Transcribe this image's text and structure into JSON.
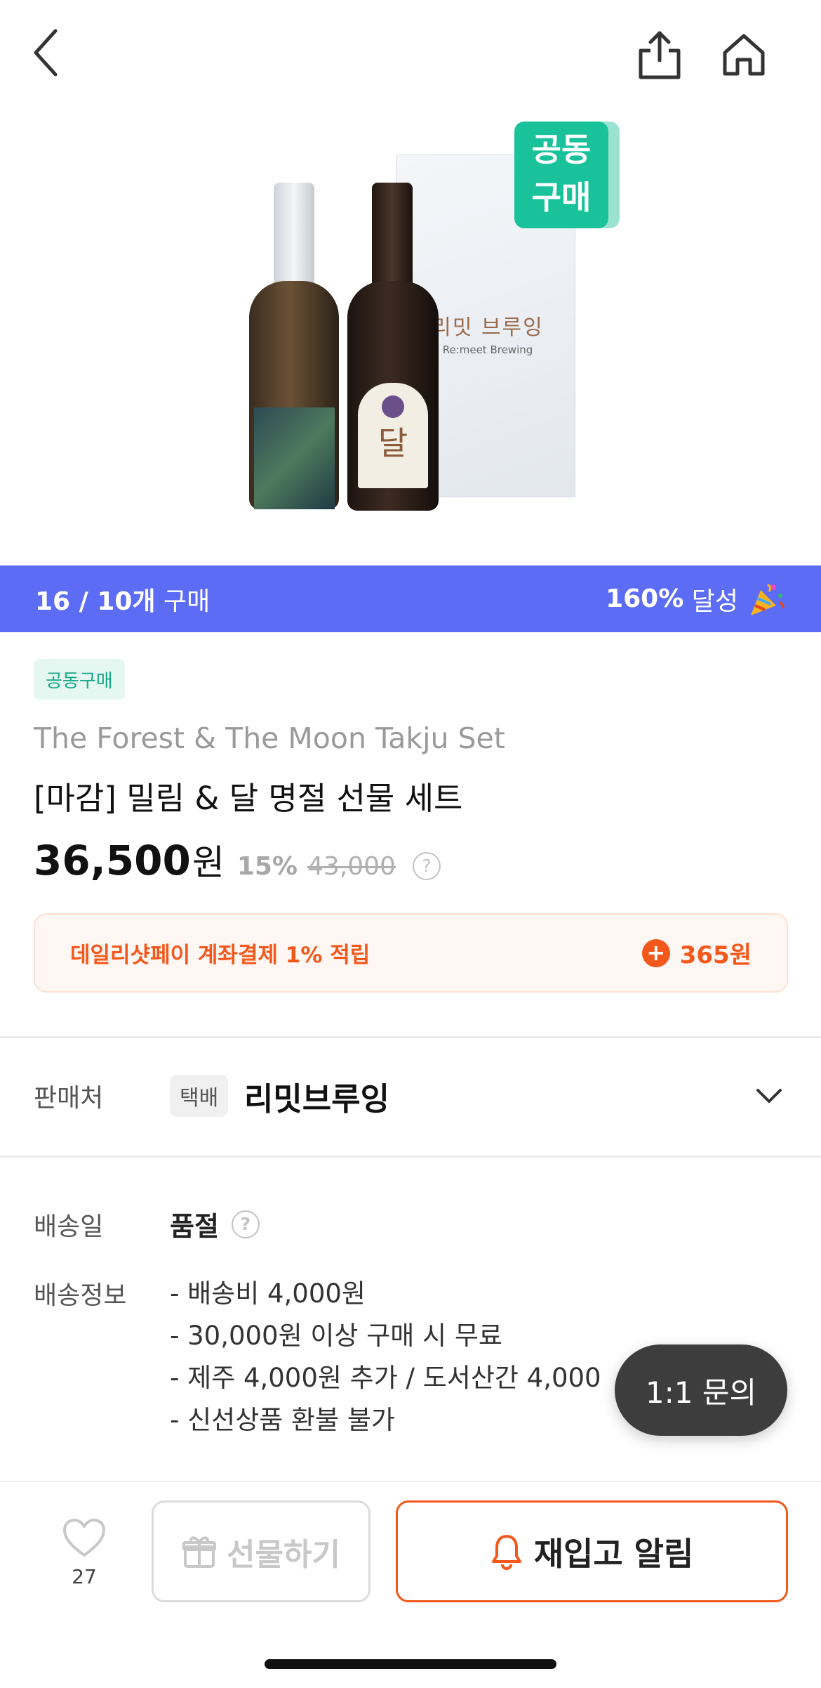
{
  "header": {
    "back_icon": "chevron-left-icon",
    "share_icon": "share-icon",
    "home_icon": "home-icon"
  },
  "hero": {
    "badge_line1": "공동",
    "badge_line2": "구매",
    "box_logo_ko": "리밋 브루잉",
    "box_logo_en": "Re:meet Brewing",
    "bottle_label": "달"
  },
  "progress": {
    "count": "16 / 10개",
    "count_suffix": "구매",
    "percent": "160%",
    "percent_suffix": "달성",
    "bar_color": "#5c6cf5"
  },
  "product": {
    "tag": "공동구매",
    "name_en": "The Forest & The Moon Takju Set",
    "name_ko": "[마감] 밀림 & 달 명절 선물 세트",
    "price": "36,500",
    "currency": "원",
    "discount": "15%",
    "original_price": "43,000"
  },
  "pay_promo": {
    "text": "데일리샷페이 계좌결제 1% 적립",
    "points": "365원",
    "accent": "#f2581c"
  },
  "seller": {
    "label": "판매처",
    "method": "택배",
    "name": "리밋브루잉"
  },
  "shipping": {
    "date_label": "배송일",
    "date_value": "품절",
    "info_label": "배송정보",
    "info_lines": [
      "- 배송비 4,000원",
      "- 30,000원 이상 구매 시 무료",
      "- 제주 4,000원 추가 / 도서산간 4,000",
      "- 신선상품 환불 불가"
    ]
  },
  "chat": {
    "label": "1:1 문의"
  },
  "bottom": {
    "like_count": "27",
    "gift_label": "선물하기",
    "restock_label": "재입고 알림"
  }
}
